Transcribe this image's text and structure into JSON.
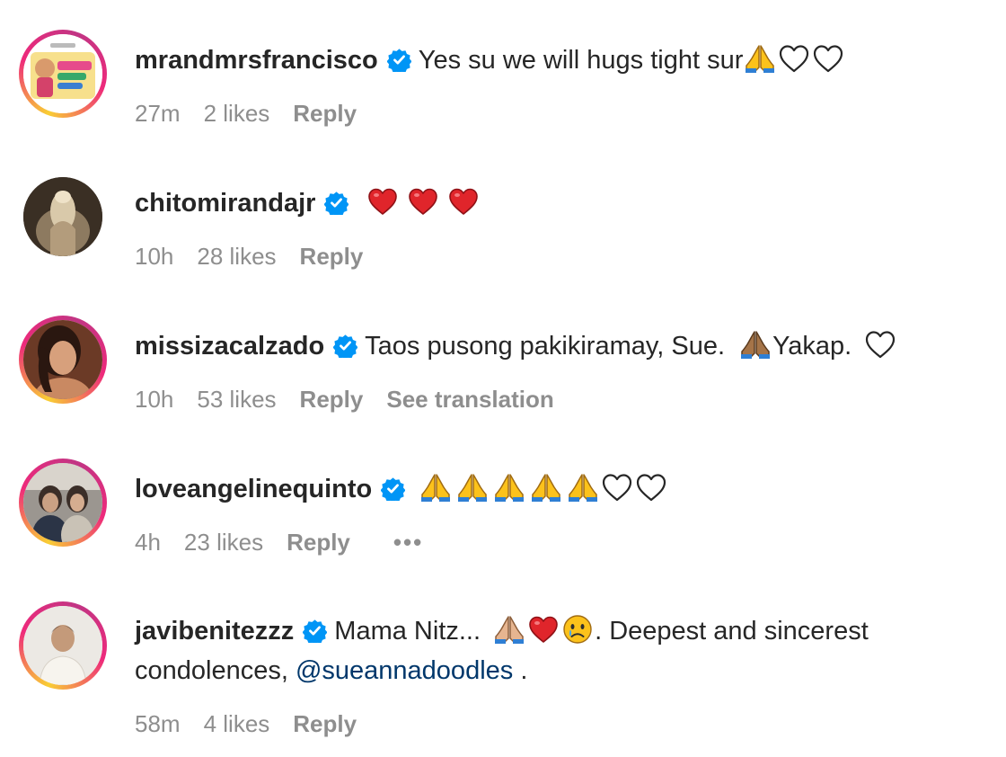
{
  "comments": [
    {
      "username": "mrandmrsfrancisco",
      "text": "Yes su we will hugs tight sur",
      "emojis": [
        "folded-hands",
        "white-heart",
        "white-heart"
      ],
      "time": "27m",
      "likes": "2 likes",
      "reply": "Reply"
    },
    {
      "username": "chitomirandajr",
      "emojis": [
        "red-heart",
        "red-heart",
        "red-heart"
      ],
      "time": "10h",
      "likes": "28 likes",
      "reply": "Reply"
    },
    {
      "username": "missizacalzado",
      "text_before": "Taos pusong pakikiramay, Sue.",
      "text_after": "Yakap.",
      "emojis": [
        "folded-hands-medium",
        "white-heart"
      ],
      "time": "10h",
      "likes": "53 likes",
      "reply": "Reply",
      "see_translation": "See translation"
    },
    {
      "username": "loveangelinequinto",
      "emojis": [
        "folded-hands",
        "folded-hands",
        "folded-hands",
        "folded-hands",
        "folded-hands",
        "white-heart",
        "white-heart"
      ],
      "time": "4h",
      "likes": "23 likes",
      "reply": "Reply",
      "more": "•••"
    },
    {
      "username": "javibenitezzz",
      "text_before": "Mama Nitz...",
      "text_mid": ". Deepest and sincerest",
      "text_line2": "condolences,",
      "mention": "@sueannadoodles",
      "text_end": ".",
      "emojis": [
        "folded-hands-light",
        "red-heart",
        "sad-face"
      ],
      "time": "58m",
      "likes": "4 likes",
      "reply": "Reply"
    }
  ],
  "colors": {
    "text": "#262626",
    "meta": "#8e8e8e",
    "verified": "#0095f6",
    "mention": "#00376b",
    "heart_red": "#e0252b"
  }
}
